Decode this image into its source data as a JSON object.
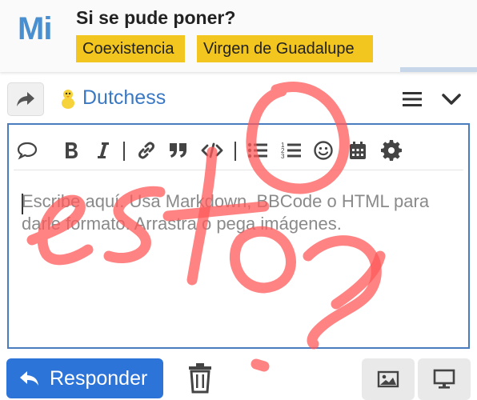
{
  "header": {
    "logo": "Mi",
    "title": "Si se pude poner?",
    "tags": [
      "Coexistencia",
      "Virgen de Guadalupe"
    ]
  },
  "reply": {
    "username": "Dutchess"
  },
  "toolbar": {
    "icons": [
      "chat-bubble-icon",
      "bold-icon",
      "italic-icon",
      "link-icon",
      "quote-icon",
      "code-icon",
      "bullet-list-icon",
      "numbered-list-icon",
      "emoji-icon",
      "calendar-icon",
      "gear-icon"
    ]
  },
  "composer": {
    "placeholder": "Escribe aquí. Usa Markdown, BBCode o HTML para darle formato. Arrastra o pega imágenes."
  },
  "footer": {
    "reply_label": "Responder"
  },
  "colors": {
    "accent": "#2d74d9",
    "tag": "#f2c51f",
    "link": "#3a78c3",
    "annotation": "#ff6b6b"
  },
  "annotation": {
    "handwritten": "esto?"
  }
}
